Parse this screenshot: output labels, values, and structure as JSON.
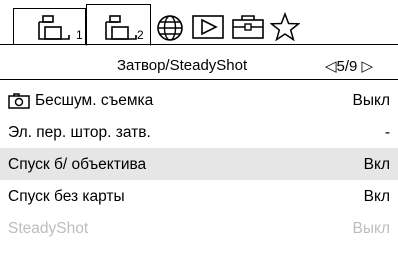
{
  "tabs": [
    {
      "icon": "camera-settings-icon",
      "number": "1"
    },
    {
      "icon": "camera-settings-icon",
      "number": "2",
      "active": true
    },
    {
      "icon": "network-globe-icon"
    },
    {
      "icon": "playback-icon"
    },
    {
      "icon": "toolbox-icon"
    },
    {
      "icon": "star-icon"
    }
  ],
  "header": {
    "title": "Затвор/SteadyShot",
    "page": "◁5/9 ▷"
  },
  "items": [
    {
      "label": "Бесшум. съемка",
      "value": "Выкл",
      "icon": "camera-icon"
    },
    {
      "label": "Эл. пер. штор. затв.",
      "value": "-"
    },
    {
      "label": "Спуск б/ объектива",
      "value": "Вкл",
      "selected": true
    },
    {
      "label": "Спуск без карты",
      "value": "Вкл"
    },
    {
      "label": "SteadyShot",
      "value": "Выкл",
      "disabled": true
    }
  ],
  "colors": {
    "selected_bg": "#e6e6e6",
    "disabled_text": "#bdbdbd"
  }
}
